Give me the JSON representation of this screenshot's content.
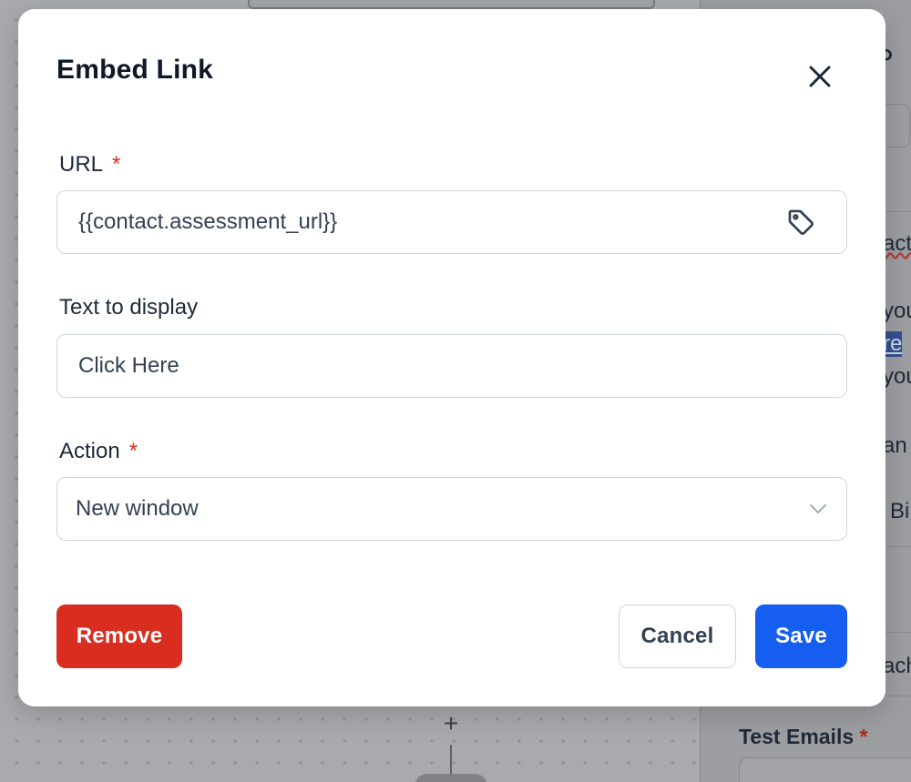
{
  "modal": {
    "title": "Embed Link",
    "url_field": {
      "label": "URL",
      "required_mark": "*",
      "value": "{{contact.assessment_url}}"
    },
    "text_field": {
      "label": "Text to display",
      "value": "Click Here"
    },
    "action_field": {
      "label": "Action",
      "required_mark": "*",
      "selected": "New window"
    },
    "buttons": {
      "remove": "Remove",
      "cancel": "Cancel",
      "save": "Save"
    }
  },
  "background": {
    "canvas": {
      "plus": "+"
    },
    "right_panel": {
      "fragments": [
        "act",
        "you",
        "re",
        "you",
        "an",
        "Bi",
        "ach"
      ],
      "test_emails_label": "Test Emails",
      "test_emails_required": "*"
    }
  },
  "colors": {
    "primary": "#155eef",
    "danger": "#d92d20",
    "border": "#d0d5dd",
    "text": "#101828"
  }
}
